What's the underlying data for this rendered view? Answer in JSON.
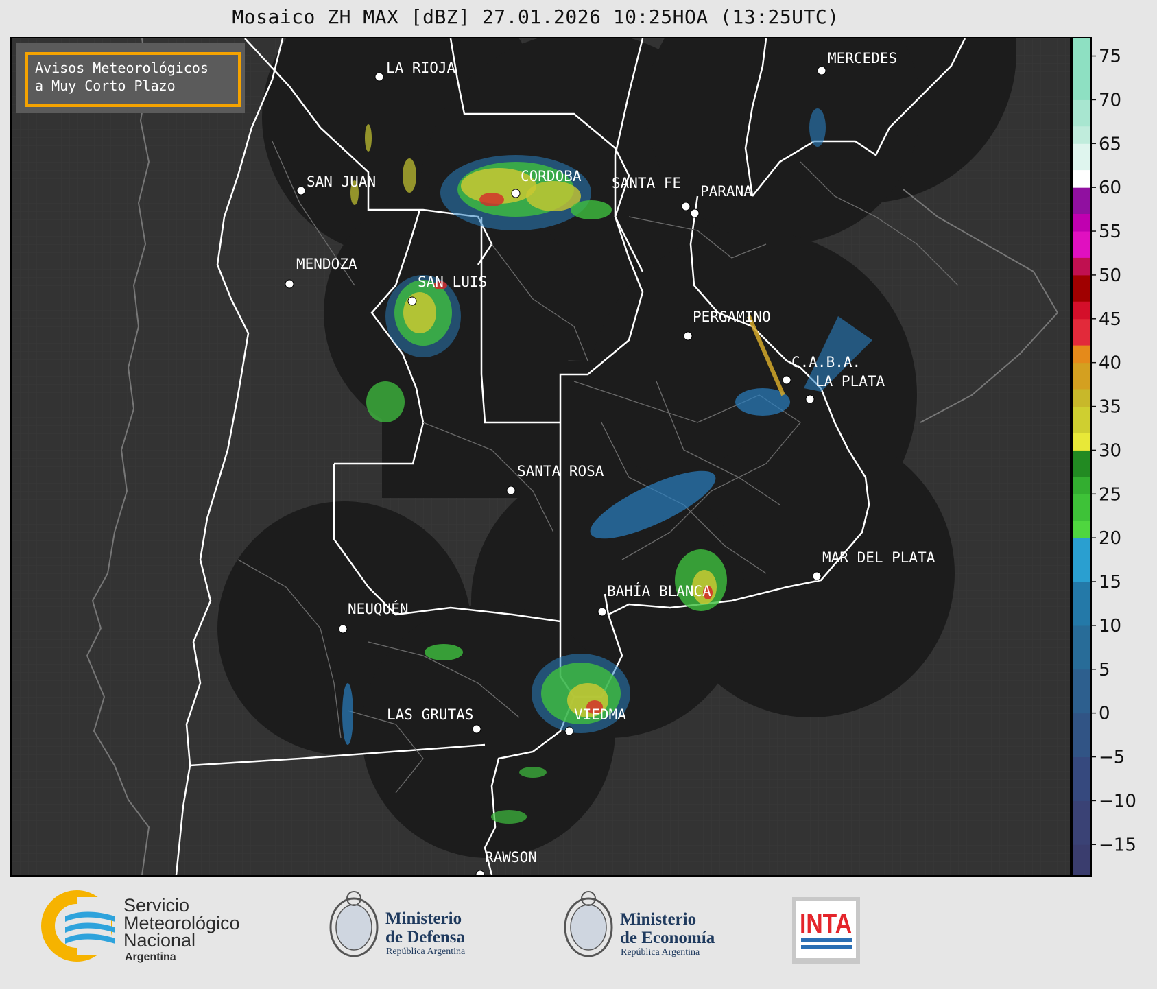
{
  "title": "Mosaico ZH MAX [dBZ] 27.01.2026 10:25HOA (13:25UTC)",
  "legend": {
    "line1": "Avisos Meteorológicos",
    "line2": "a Muy Corto Plazo"
  },
  "cities": [
    {
      "name": "LA RIOJA"
    },
    {
      "name": "SAN JUAN"
    },
    {
      "name": "CORDOBA"
    },
    {
      "name": "SANTA FE"
    },
    {
      "name": "PARANA"
    },
    {
      "name": "MENDOZA"
    },
    {
      "name": "SAN LUIS"
    },
    {
      "name": "PERGAMINO"
    },
    {
      "name": "C.A.B.A."
    },
    {
      "name": "LA PLATA"
    },
    {
      "name": "SANTA ROSA"
    },
    {
      "name": "MAR DEL PLATA"
    },
    {
      "name": "BAHÍA BLANCA"
    },
    {
      "name": "NEUQUÉN"
    },
    {
      "name": "LAS GRUTAS"
    },
    {
      "name": "VIEDMA"
    },
    {
      "name": "RAWSON"
    },
    {
      "name": "MERCEDES"
    }
  ],
  "colorbar": {
    "min": -18.5,
    "max": 77,
    "ticks": [
      "75",
      "70",
      "65",
      "60",
      "55",
      "50",
      "45",
      "40",
      "35",
      "30",
      "25",
      "20",
      "15",
      "10",
      "5",
      "0",
      "−5",
      "−10",
      "−15"
    ]
  },
  "logos": {
    "smn_line1": "Servicio",
    "smn_line2": "Meteorológico",
    "smn_line3": "Nacional",
    "smn_line4": "Argentina",
    "defensa_line1": "Ministerio",
    "defensa_line2": "de Defensa",
    "defensa_line3": "República Argentina",
    "economia_line1": "Ministerio",
    "economia_line2": "de Economía",
    "economia_line3": "República Argentina",
    "inta": "INTA"
  }
}
